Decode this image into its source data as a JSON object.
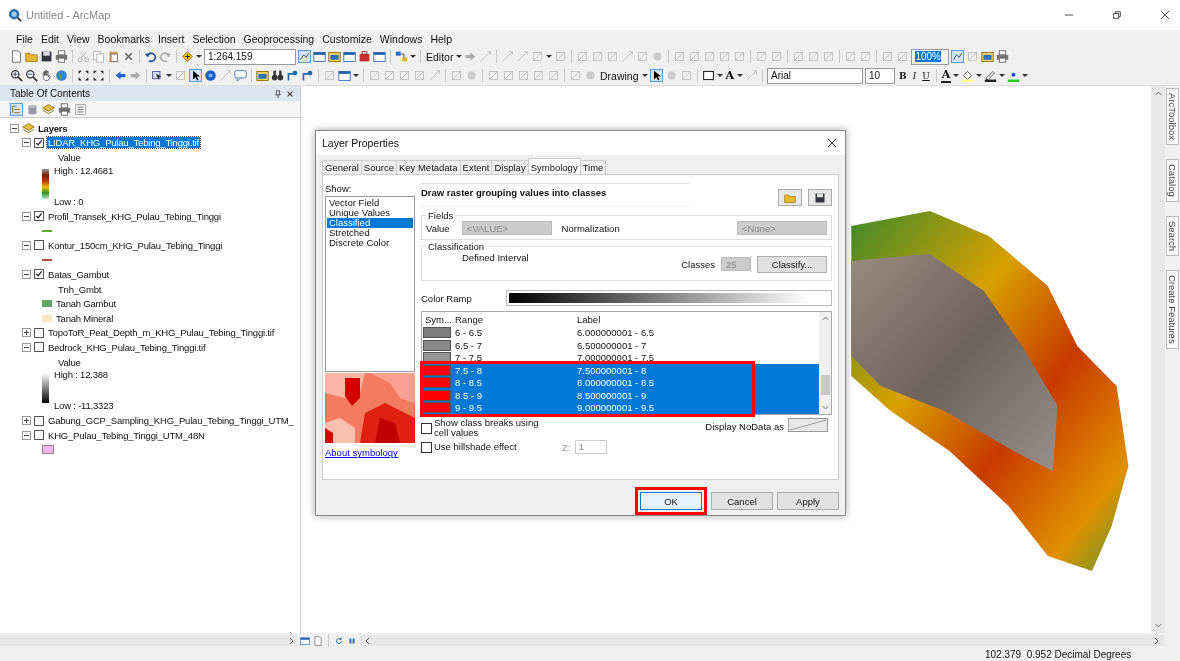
{
  "window": {
    "title": "Untitled - ArcMap"
  },
  "menu": [
    "File",
    "Edit",
    "View",
    "Bookmarks",
    "Insert",
    "Selection",
    "Geoprocessing",
    "Customize",
    "Windows",
    "Help"
  ],
  "standard_toolbar": {
    "scale": "1:264.159",
    "editor": "Editor",
    "zoom": "100%"
  },
  "drawing_toolbar": {
    "label": "Drawing",
    "text_tool": "A",
    "font": "Arial",
    "font_size": "10",
    "format_buttons": [
      "B",
      "I",
      "U"
    ],
    "font_color": "A"
  },
  "toc": {
    "title": "Table Of Contents",
    "root": {
      "label": "Layers",
      "expanded": true
    },
    "layers": [
      {
        "name": "LIDAR_KHG_Pulau_Tebing_Tinggi.tif",
        "checked": true,
        "expanded": true,
        "selected": true,
        "legend": {
          "kind": "color_ramp",
          "heading": "Value",
          "high": "High : 12.4681",
          "low": "Low : 0"
        }
      },
      {
        "name": "Profil_Transek_KHG_Pulau_Tebing_Tinggi",
        "checked": true,
        "expanded": true,
        "selected": false,
        "legend": {
          "kind": "line",
          "color": "#5aaa28"
        }
      },
      {
        "name": "Kontur_150cm_KHG_Pulau_Tebing_Tinggi",
        "checked": false,
        "expanded": true,
        "selected": false,
        "legend": {
          "kind": "line",
          "color": "#b84a3a"
        }
      },
      {
        "name": "Batas_Gambut",
        "checked": true,
        "expanded": true,
        "selected": false,
        "legend": {
          "kind": "classes",
          "heading": "Tnh_Gmbt",
          "items": [
            {
              "label": "Tanah Gambut",
              "color": "#5fa862"
            },
            {
              "label": "Tanah Mineral",
              "color": "#fde6c2"
            }
          ]
        }
      },
      {
        "name": "TopoToR_Peat_Depth_m_KHG_Pulau_Tebing_Tinggi.tif",
        "checked": false,
        "expanded": false,
        "selected": false
      },
      {
        "name": "Bedrock_KHG_Pulau_Tebing_Tinggi.tif",
        "checked": false,
        "expanded": true,
        "selected": false,
        "legend": {
          "kind": "gray_ramp",
          "heading": "Value",
          "high": "High : 12.388",
          "low": "Low : -11.3323"
        }
      },
      {
        "name": "Gabung_GCP_Sampling_KHG_Pulau_Tebing_Tinggi_UTM_",
        "checked": false,
        "expanded": false,
        "selected": false
      },
      {
        "name": "KHG_Pulau_Tebing_Tinggi_UTM_48N",
        "checked": false,
        "expanded": true,
        "selected": false,
        "legend": {
          "kind": "fill",
          "color": "#eeb4ee"
        }
      }
    ]
  },
  "side_tabs": [
    "ArcToolbox",
    "Catalog",
    "Search",
    "Create Features"
  ],
  "dialog": {
    "title": "Layer Properties",
    "tabs": [
      {
        "label": "General",
        "selected": false
      },
      {
        "label": "Source",
        "selected": false
      },
      {
        "label": "Key Metadata",
        "selected": false
      },
      {
        "label": "Extent",
        "selected": false
      },
      {
        "label": "Display",
        "selected": false
      },
      {
        "label": "Symbology",
        "selected": true
      },
      {
        "label": "Time",
        "selected": false
      }
    ],
    "show_label": "Show:",
    "show_items": [
      {
        "label": "Vector Field",
        "selected": false
      },
      {
        "label": "Unique Values",
        "selected": false
      },
      {
        "label": "Classified",
        "selected": true
      },
      {
        "label": "Stretched",
        "selected": false
      },
      {
        "label": "Discrete Color",
        "selected": false
      }
    ],
    "about_link": "About symbology",
    "heading": "Draw raster grouping values into classes",
    "fields": {
      "group": "Fields",
      "value_label": "Value",
      "value": "<VALUE>",
      "normalization_label": "Normalization",
      "normalization": "<None>"
    },
    "classification": {
      "group": "Classification",
      "method": "Defined Interval",
      "classes_label": "Classes",
      "classes": "25",
      "classify_button": "Classify..."
    },
    "color_ramp_label": "Color Ramp",
    "table": {
      "columns": [
        "Sym...",
        "Range",
        "Label"
      ],
      "highlight_selection": true,
      "rows": [
        {
          "color": "#7c7c7c",
          "range": "6 - 6.5",
          "label": "6.000000001 - 6.5",
          "selected": false
        },
        {
          "color": "#888888",
          "range": "6.5 - 7",
          "label": "6.500000001 - 7",
          "selected": false
        },
        {
          "color": "#949494",
          "range": "7 - 7.5",
          "label": "7.000000001 - 7.5",
          "selected": false
        },
        {
          "color": "#ff0000",
          "range": "7.5 - 8",
          "label": "7.500000001 - 8",
          "selected": true
        },
        {
          "color": "#ff0000",
          "range": "8 - 8.5",
          "label": "8.000000001 - 8.5",
          "selected": true
        },
        {
          "color": "#ff0000",
          "range": "8.5 - 9",
          "label": "8.500000001 - 9",
          "selected": true
        },
        {
          "color": "#ff0000",
          "range": "9 - 9.5",
          "label": "9.000000001 - 9.5",
          "selected": true
        }
      ]
    },
    "options": [
      {
        "label": "Show class breaks using cell values",
        "checked": false
      },
      {
        "label": "Use hillshade effect",
        "checked": false
      }
    ],
    "z_label": "Z:",
    "z_value": "1",
    "nodata_label": "Display NoData as",
    "buttons": [
      {
        "label": "OK",
        "highlighted": true
      },
      {
        "label": "Cancel",
        "highlighted": false
      },
      {
        "label": "Apply",
        "highlighted": false
      }
    ]
  },
  "status_bar": {
    "coordinates": "102.379  0.952 Decimal Degrees"
  }
}
